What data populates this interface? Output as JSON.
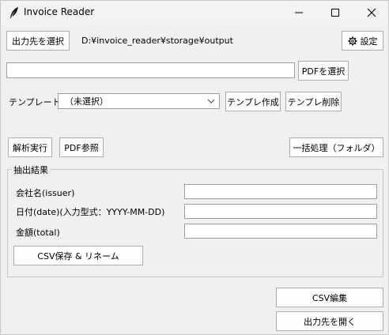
{
  "window": {
    "title": "Invoice Reader",
    "icons": {
      "app": "feather-icon",
      "minimize": "minimize-icon",
      "maximize": "maximize-icon",
      "close": "close-icon"
    }
  },
  "output": {
    "select_button": "出力先を選択",
    "path": "D:¥invoice_reader¥storage¥output",
    "settings_button": "設定",
    "settings_icon": "gear-icon"
  },
  "pdf": {
    "path_value": "",
    "select_button": "PDFを選択"
  },
  "template": {
    "label": "テンプレート:",
    "selected": "（未選択）",
    "create_button": "テンプレ作成",
    "delete_button": "テンプレ削除"
  },
  "actions": {
    "analyze": "解析実行",
    "pdf_view": "PDF参照",
    "batch": "一括処理（フォルダ）"
  },
  "results": {
    "title": "抽出結果",
    "issuer_label": "会社名(issuer)",
    "date_label": "日付(date)(入力型式：YYYY-MM-DD)",
    "total_label": "金額(total)",
    "issuer_value": "",
    "date_value": "",
    "total_value": "",
    "save_button": "CSV保存 & リネーム"
  },
  "footer": {
    "csv_edit": "CSV編集",
    "open_output": "出力先を開く"
  }
}
